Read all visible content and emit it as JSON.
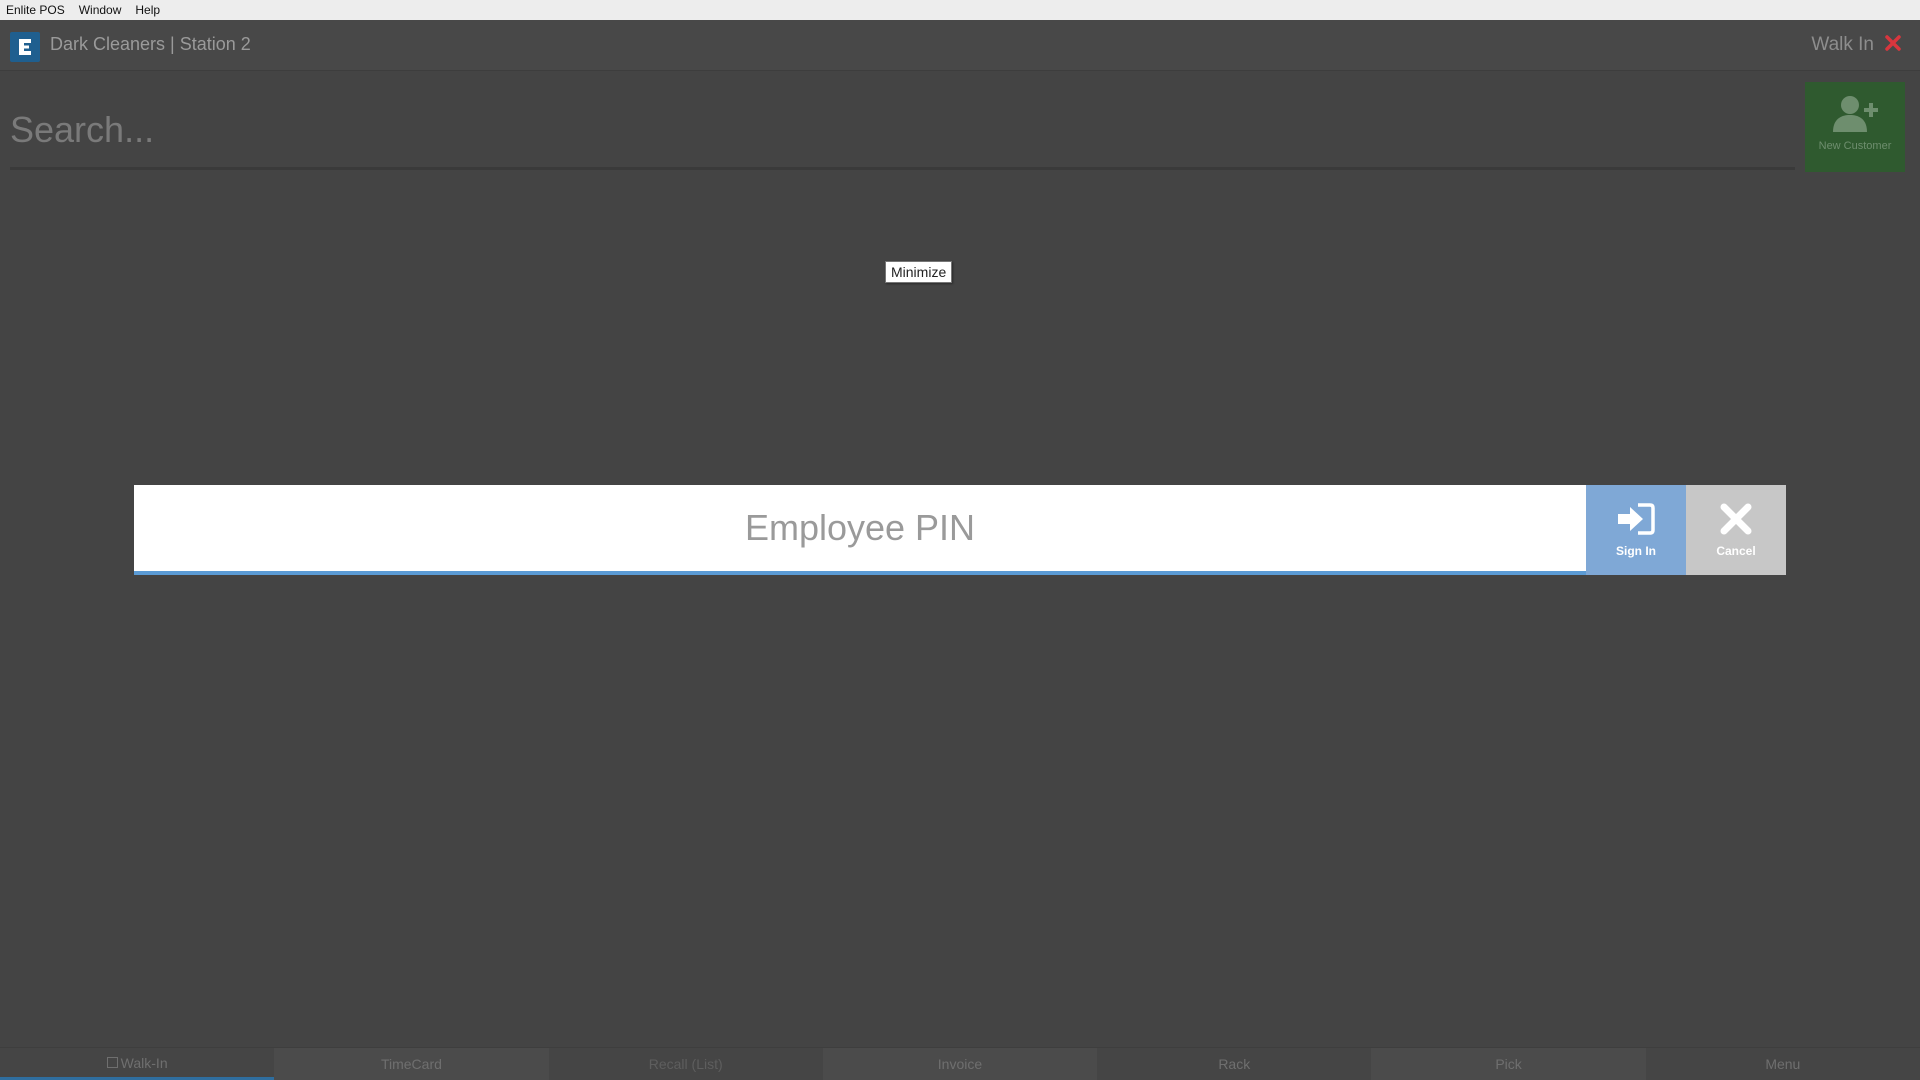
{
  "menubar": {
    "items": [
      "Enlite POS",
      "Window",
      "Help"
    ]
  },
  "header": {
    "title": "Dark Cleaners | Station 2",
    "walk_in_label": "Walk In",
    "close_color": "#d9363e"
  },
  "search": {
    "placeholder": "Search...",
    "value": ""
  },
  "new_customer": {
    "label": "New Customer",
    "color": "#2f5a2f"
  },
  "tooltip": {
    "text": "Minimize"
  },
  "pin_dialog": {
    "placeholder": "Employee PIN",
    "value": "",
    "sign_in_label": "Sign In",
    "cancel_label": "Cancel",
    "accent": "#5b9bd5"
  },
  "bottom_tabs": [
    {
      "label": "Walk-In",
      "active": true
    },
    {
      "label": "TimeCard"
    },
    {
      "label": "Recall (List)",
      "disabled": true
    },
    {
      "label": "Invoice"
    },
    {
      "label": "Rack"
    },
    {
      "label": "Pick"
    },
    {
      "label": "Menu"
    }
  ]
}
